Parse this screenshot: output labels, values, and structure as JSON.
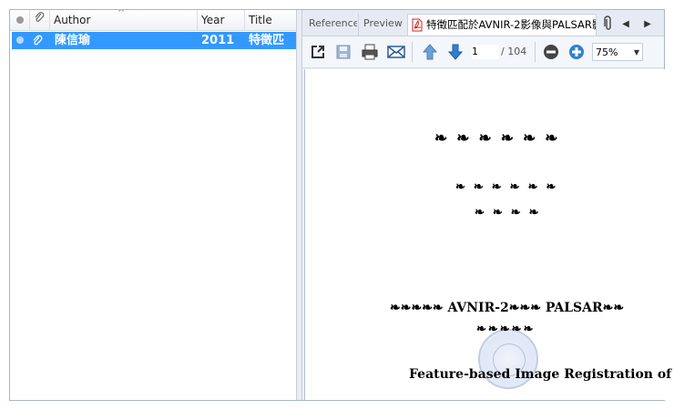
{
  "left_pane": {
    "columns": {
      "attachment_header_icon": "paperclip-icon",
      "author": "Author",
      "year": "Year",
      "title": "Title",
      "sort_indicator": "^"
    },
    "rows": [
      {
        "author": "陳信瑜",
        "year": "2011",
        "title": "特徵匹"
      }
    ]
  },
  "right_pane": {
    "tabs": {
      "reference": "Reference",
      "preview": "Preview",
      "document": "特徵匹配於AVNIR-2影像與PALSAR影"
    },
    "toolbar": {
      "current_page": "1",
      "page_total": "/ 104",
      "zoom": "75%",
      "icons": [
        "open-external-icon",
        "save-icon",
        "print-icon",
        "email-icon",
        "arrow-up-icon",
        "arrow-down-icon",
        "zoom-out-icon",
        "zoom-in-icon"
      ]
    },
    "document": {
      "line1": "❧❧❧❧❧❧",
      "line2": "❧❧❧❧❧❧",
      "line3": "❧❧❧❧",
      "title_cjk_line": "❧❧❧❧❧ AVNIR-2❧❧❧ PALSAR❧❧",
      "title_cjk_line2": "❧❧❧❧❧",
      "title_en": "Feature-based Image Registration of"
    }
  },
  "colors": {
    "selection": "#3399ff",
    "accent_arrow": "#2f7fd0",
    "pdf_red": "#cc2222"
  }
}
